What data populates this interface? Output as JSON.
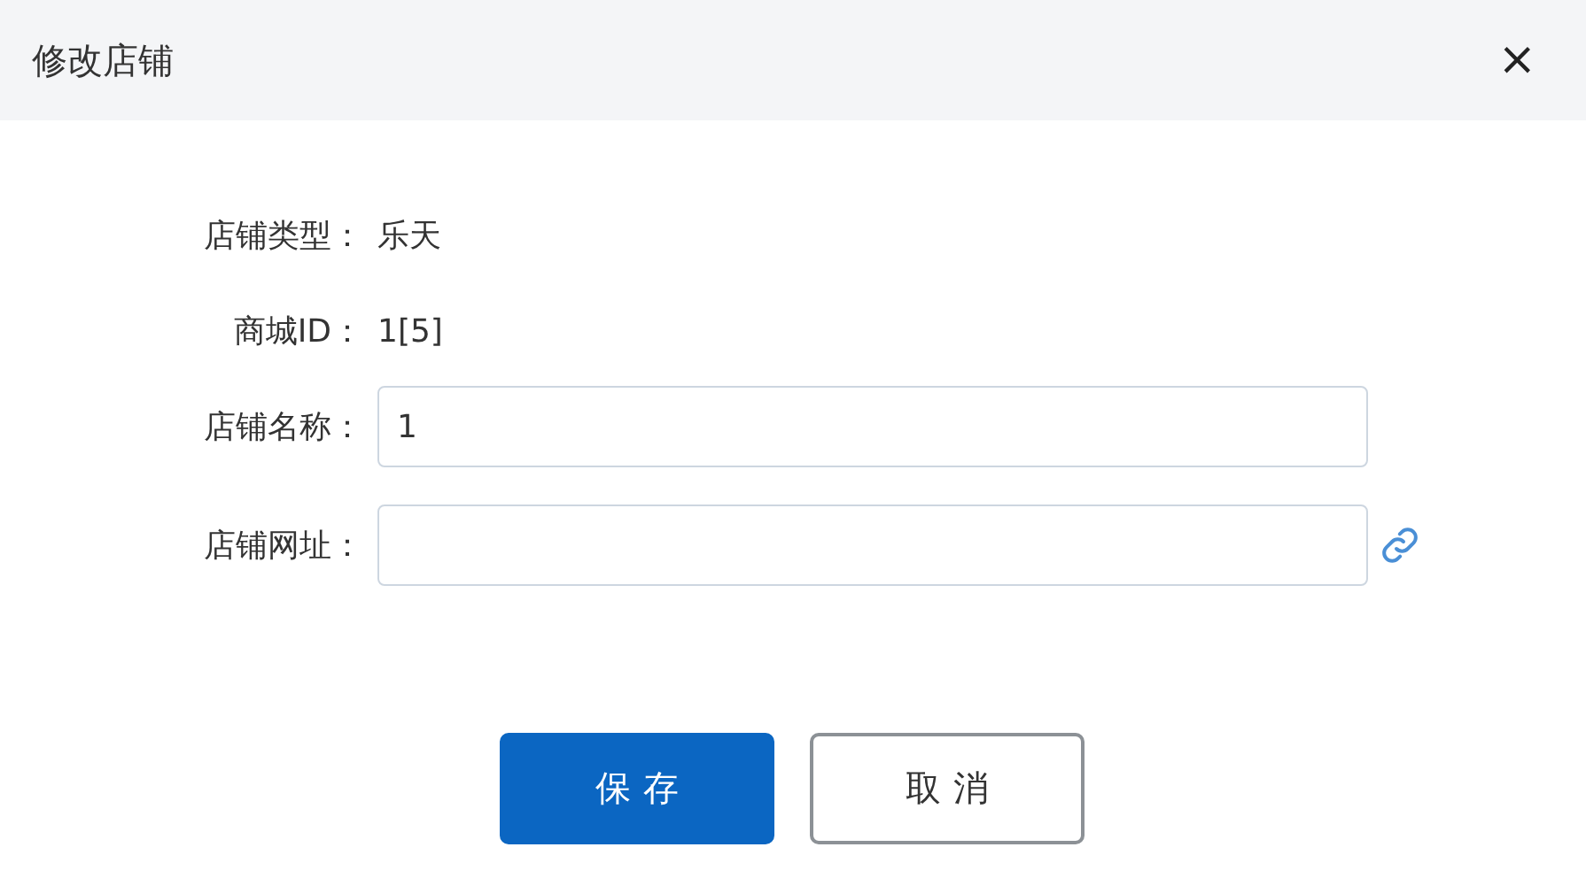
{
  "window": {
    "title": "修改店铺",
    "close": "×"
  },
  "fields": [
    {
      "kind": "text",
      "label": "店铺类型：",
      "value": "乐天"
    },
    {
      "kind": "text",
      "label": "商城ID：",
      "value": "1[5]"
    },
    {
      "kind": "input",
      "label": "店铺名称：",
      "value": "1",
      "link_icon": false
    },
    {
      "kind": "input",
      "label": "店铺网址：",
      "link_icon": true
    }
  ],
  "buttons": [
    {
      "kind": "primary",
      "label": "保存"
    },
    {
      "kind": "default",
      "label": "取消"
    }
  ]
}
